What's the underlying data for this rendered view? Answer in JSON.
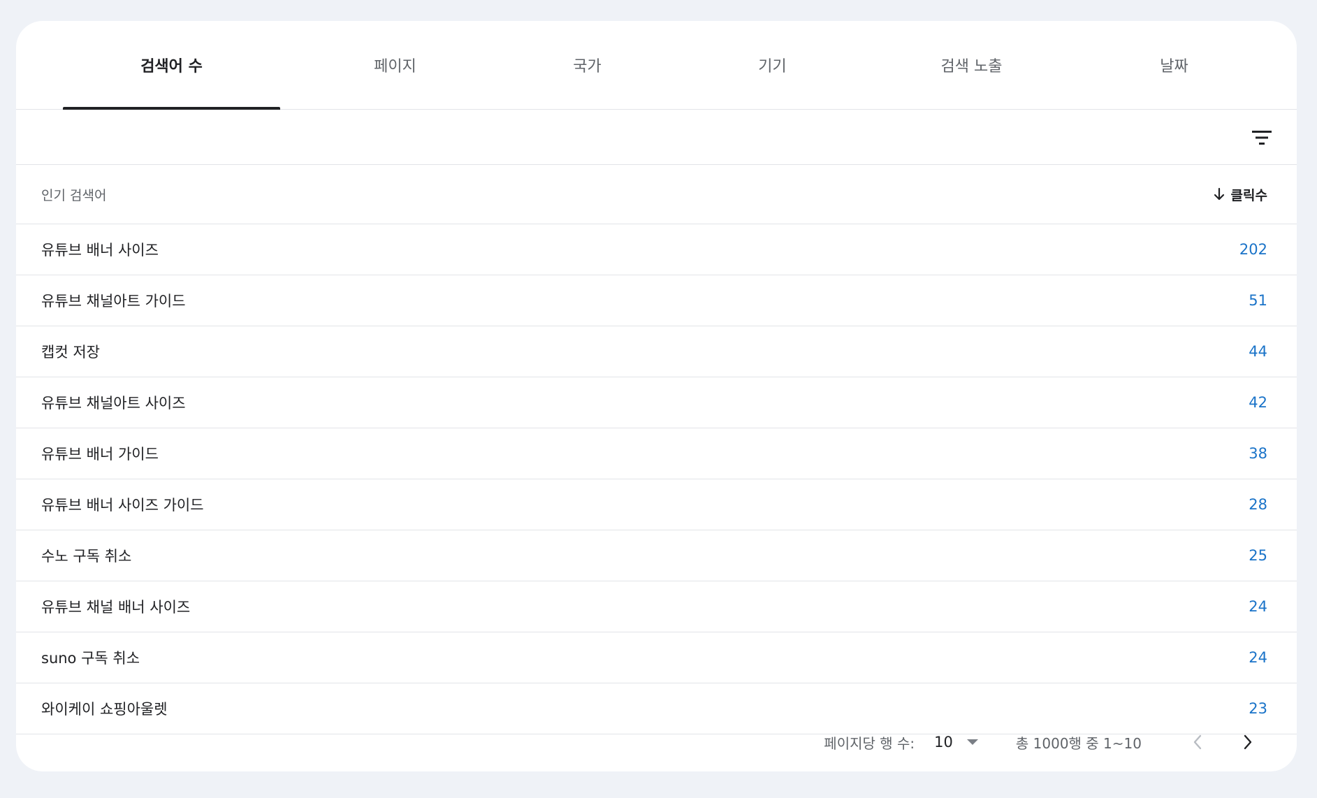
{
  "tabs": [
    {
      "label": "검색어 수",
      "active": true
    },
    {
      "label": "페이지",
      "active": false
    },
    {
      "label": "국가",
      "active": false
    },
    {
      "label": "기기",
      "active": false
    },
    {
      "label": "검색 노출",
      "active": false
    },
    {
      "label": "날짜",
      "active": false
    }
  ],
  "table": {
    "header_query": "인기 검색어",
    "header_clicks": "클릭수",
    "sort_icon": "arrow-down-icon",
    "rows": [
      {
        "query": "유튜브 배너 사이즈",
        "clicks": "202"
      },
      {
        "query": "유튜브 채널아트 가이드",
        "clicks": "51"
      },
      {
        "query": "캡컷 저장",
        "clicks": "44"
      },
      {
        "query": "유튜브 채널아트 사이즈",
        "clicks": "42"
      },
      {
        "query": "유튜브 배너 가이드",
        "clicks": "38"
      },
      {
        "query": "유튜브 배너 사이즈 가이드",
        "clicks": "28"
      },
      {
        "query": "수노 구독 취소",
        "clicks": "25"
      },
      {
        "query": "유튜브 채널 배너 사이즈",
        "clicks": "24"
      },
      {
        "query": "suno 구독 취소",
        "clicks": "24"
      },
      {
        "query": "와이케이 쇼핑아울렛",
        "clicks": "23"
      }
    ]
  },
  "pagination": {
    "rows_per_page_label": "페이지당 행 수:",
    "rows_per_page_value": "10",
    "range_text": "총 1000행 중 1~10"
  },
  "colors": {
    "background": "#eff2f7",
    "clicks_accent": "#1a73c8",
    "active_indicator": "#202124"
  }
}
